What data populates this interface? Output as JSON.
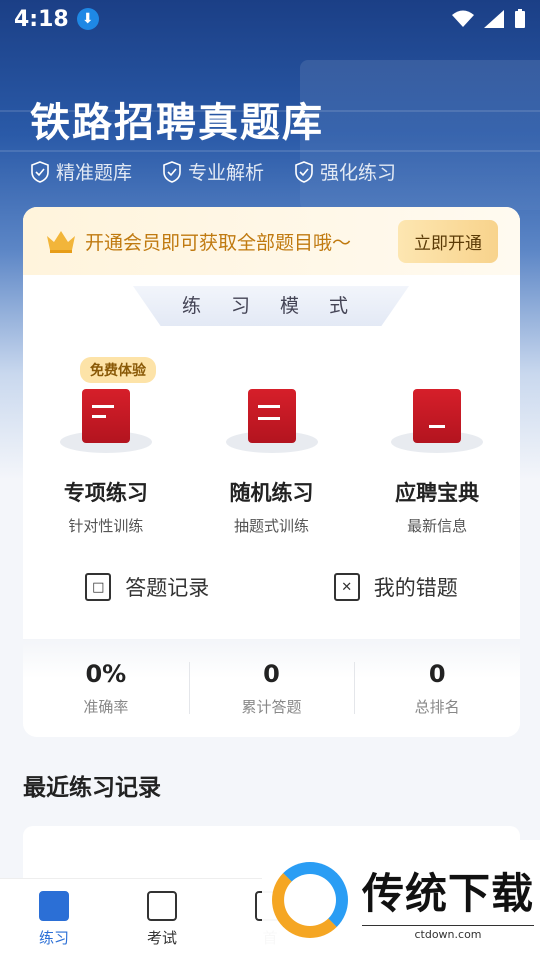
{
  "status_bar": {
    "time": "4:18"
  },
  "header": {
    "title": "铁路招聘真题库",
    "tags": [
      "精准题库",
      "专业解析",
      "强化练习"
    ]
  },
  "vip_banner": {
    "text": "开通会员即可获取全部题目哦～",
    "button": "立即开通"
  },
  "practice_mode": {
    "label": "练 习 模 式",
    "items": [
      {
        "name": "专项练习",
        "sub": "针对性训练",
        "badge": "免费体验"
      },
      {
        "name": "随机练习",
        "sub": "抽题式训练"
      },
      {
        "name": "应聘宝典",
        "sub": "最新信息"
      }
    ]
  },
  "links": [
    "答题记录",
    "我的错题"
  ],
  "stats": [
    {
      "value": "0%",
      "label": "准确率"
    },
    {
      "value": "0",
      "label": "累计答题"
    },
    {
      "value": "0",
      "label": "总排名"
    }
  ],
  "recent": {
    "title": "最近练习记录"
  },
  "nav": [
    "练习",
    "考试",
    "首"
  ],
  "watermark": {
    "brand": "传统下载",
    "url": "ctdown.com"
  },
  "colors": {
    "accent": "#2b6fd6",
    "red": "#d61f2a",
    "gold": "#f8d38c"
  }
}
